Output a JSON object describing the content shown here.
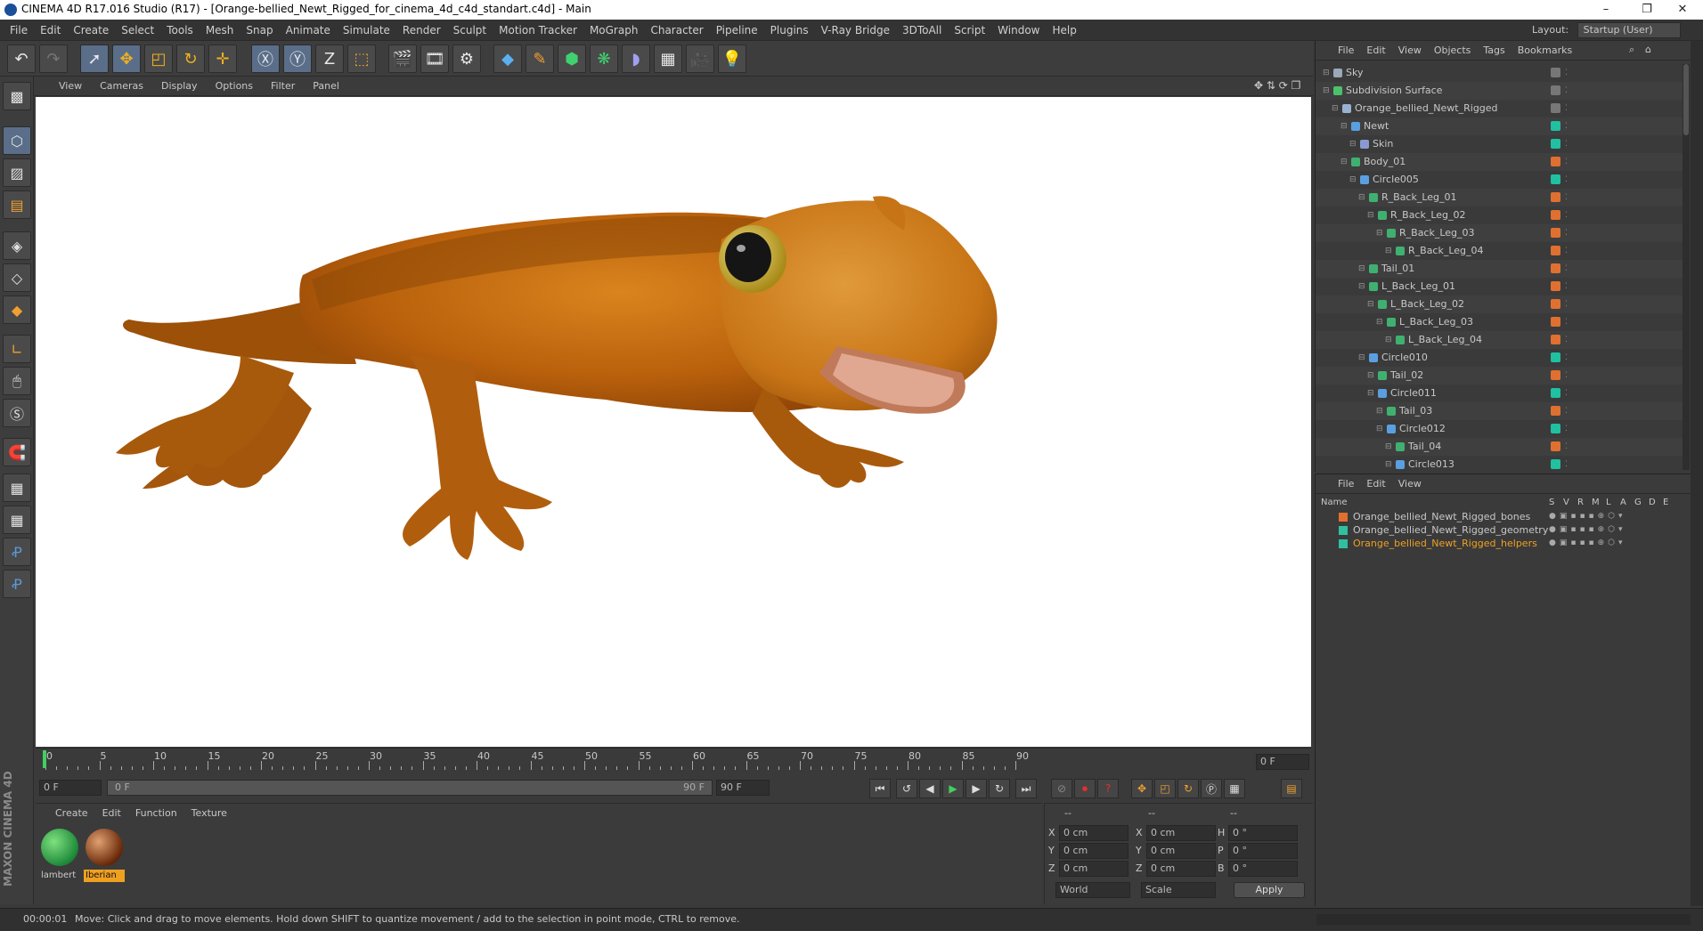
{
  "window": {
    "title": "CINEMA 4D R17.016 Studio (R17) - [Orange-bellied_Newt_Rigged_for_cinema_4d_c4d_standart.c4d] - Main"
  },
  "menu": [
    "File",
    "Edit",
    "Create",
    "Select",
    "Tools",
    "Mesh",
    "Snap",
    "Animate",
    "Simulate",
    "Render",
    "Sculpt",
    "Motion Tracker",
    "MoGraph",
    "Character",
    "Pipeline",
    "Plugins",
    "V-Ray Bridge",
    "3DToAll",
    "Script",
    "Window",
    "Help"
  ],
  "layout": {
    "label": "Layout:",
    "value": "Startup (User)"
  },
  "viewport_menu": [
    "View",
    "Cameras",
    "Display",
    "Options",
    "Filter",
    "Panel"
  ],
  "object_manager": {
    "menu": [
      "File",
      "Edit",
      "View",
      "Objects",
      "Tags",
      "Bookmarks"
    ],
    "rows": [
      {
        "name": "Sky",
        "depth": 0,
        "icon": "#9aa8b8"
      },
      {
        "name": "Subdivision Surface",
        "depth": 0,
        "icon": "#4cc06a"
      },
      {
        "name": "Orange_bellied_Newt_Rigged",
        "depth": 1,
        "icon": "#9ab0d0"
      },
      {
        "name": "Newt",
        "depth": 2,
        "icon": "#5aa0e0"
      },
      {
        "name": "Skin",
        "depth": 3,
        "icon": "#8a9ad0"
      },
      {
        "name": "Body_01",
        "depth": 2,
        "icon": "#40b070"
      },
      {
        "name": "Circle005",
        "depth": 3,
        "icon": "#5aa0e0"
      },
      {
        "name": "R_Back_Leg_01",
        "depth": 4,
        "icon": "#40b070"
      },
      {
        "name": "R_Back_Leg_02",
        "depth": 5,
        "icon": "#40b070"
      },
      {
        "name": "R_Back_Leg_03",
        "depth": 6,
        "icon": "#40b070"
      },
      {
        "name": "R_Back_Leg_04",
        "depth": 7,
        "icon": "#40b070"
      },
      {
        "name": "Tail_01",
        "depth": 4,
        "icon": "#40b070"
      },
      {
        "name": "L_Back_Leg_01",
        "depth": 4,
        "icon": "#40b070"
      },
      {
        "name": "L_Back_Leg_02",
        "depth": 5,
        "icon": "#40b070"
      },
      {
        "name": "L_Back_Leg_03",
        "depth": 6,
        "icon": "#40b070"
      },
      {
        "name": "L_Back_Leg_04",
        "depth": 7,
        "icon": "#40b070"
      },
      {
        "name": "Circle010",
        "depth": 4,
        "icon": "#5aa0e0"
      },
      {
        "name": "Tail_02",
        "depth": 5,
        "icon": "#40b070"
      },
      {
        "name": "Circle011",
        "depth": 5,
        "icon": "#5aa0e0"
      },
      {
        "name": "Tail_03",
        "depth": 6,
        "icon": "#40b070"
      },
      {
        "name": "Circle012",
        "depth": 6,
        "icon": "#5aa0e0"
      },
      {
        "name": "Tail_04",
        "depth": 7,
        "icon": "#40b070"
      },
      {
        "name": "Circle013",
        "depth": 7,
        "icon": "#5aa0e0"
      }
    ]
  },
  "layer_manager": {
    "menu": [
      "File",
      "Edit",
      "View"
    ],
    "columns": [
      "Name",
      "S",
      "V",
      "R",
      "M",
      "L",
      "A",
      "G",
      "D",
      "E"
    ],
    "rows": [
      {
        "name": "Orange_bellied_Newt_Rigged_bones",
        "color": "#e07030",
        "highlight": false
      },
      {
        "name": "Orange_bellied_Newt_Rigged_geometry",
        "color": "#30c0a0",
        "highlight": false
      },
      {
        "name": "Orange_bellied_Newt_Rigged_helpers",
        "color": "#30c0a0",
        "highlight": true
      }
    ]
  },
  "timeline": {
    "ticks": [
      "0",
      "5",
      "10",
      "15",
      "20",
      "25",
      "30",
      "35",
      "40",
      "45",
      "50",
      "55",
      "60",
      "65",
      "70",
      "75",
      "80",
      "85",
      "90"
    ],
    "current_frame": "0 F",
    "start": "0 F",
    "range_start": "0 F",
    "range_end": "90 F",
    "end": "90 F"
  },
  "material_manager": {
    "menu": [
      "Create",
      "Edit",
      "Function",
      "Texture"
    ],
    "materials": [
      {
        "name": "lambert",
        "selected": false
      },
      {
        "name": "Iberian",
        "selected": true
      }
    ]
  },
  "coordinates": {
    "headers": [
      "--",
      "--",
      "--"
    ],
    "rows": [
      {
        "a": "X",
        "av": "0 cm",
        "b": "X",
        "bv": "0 cm",
        "c": "H",
        "cv": "0 °"
      },
      {
        "a": "Y",
        "av": "0 cm",
        "b": "Y",
        "bv": "0 cm",
        "c": "P",
        "cv": "0 °"
      },
      {
        "a": "Z",
        "av": "0 cm",
        "b": "Z",
        "bv": "0 cm",
        "c": "B",
        "cv": "0 °"
      }
    ],
    "world": "World",
    "scale": "Scale",
    "apply": "Apply"
  },
  "brand": "MAXON CINEMA 4D",
  "status": {
    "time": "00:00:01",
    "message": "Move: Click and drag to move elements. Hold down SHIFT to quantize movement / add to the selection in point mode, CTRL to remove."
  }
}
